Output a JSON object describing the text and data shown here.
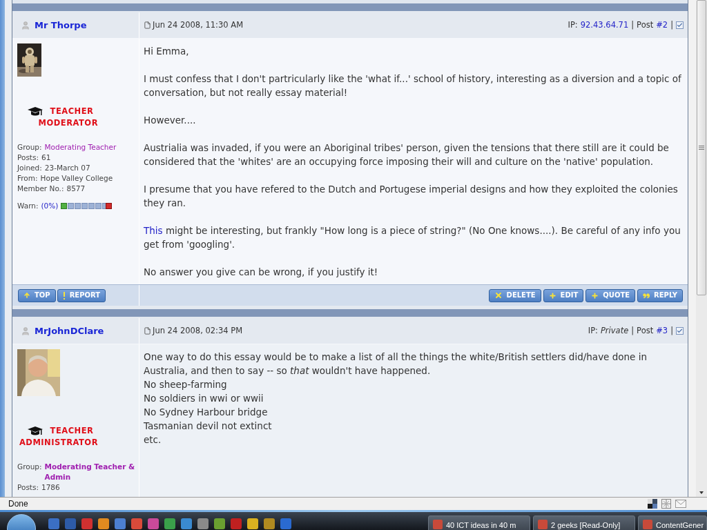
{
  "posts": [
    {
      "author": "Mr Thorpe",
      "date": "Jun 24 2008, 11:30 AM",
      "ip_label": "IP:",
      "ip": "92.43.64.71",
      "ip_private": false,
      "separators": [
        "|",
        "|"
      ],
      "post_label": "Post",
      "post_no": "#2",
      "checked": true,
      "avatar": {
        "kind": "picture"
      },
      "rank": [
        "TEACHER",
        "MODERATOR"
      ],
      "details": [
        {
          "label": "Group:",
          "value": "Moderating Teacher",
          "kind": "group",
          "bold": false
        },
        {
          "label": "Posts:",
          "value": "61",
          "kind": "plain"
        },
        {
          "label": "Joined:",
          "value": "23-March 07",
          "kind": "plain"
        },
        {
          "label": "From:",
          "value": "Hope Valley College",
          "kind": "plain"
        },
        {
          "label": "Member No.:",
          "value": "8577",
          "kind": "plain"
        }
      ],
      "warn": {
        "label": "Warn:",
        "value": "(0%)"
      },
      "body": [
        [
          {
            "text": "Hi Emma,"
          }
        ],
        [
          {
            "text": "I must confess that I don't partricularly like the 'what if...' school of history, interesting as a diversion and a topic of conversation, but not really essay material!"
          }
        ],
        [
          {
            "text": "However...."
          }
        ],
        [
          {
            "text": "Austrialia was invaded, if you were an Aboriginal tribes' person, given the tensions that there still are it could be considered that the 'whites' are an occupying force imposing their will and culture on the 'native' population."
          }
        ],
        [
          {
            "text": "I presume that you have refered to the Dutch and Portugese imperial designs and how they exploited the colonies they ran."
          }
        ],
        [
          {
            "link": "This",
            "text": " might be interesting, but frankly \"How long is a piece of string?\" (No One knows....). Be careful of any info you get from 'googling'."
          }
        ],
        [
          {
            "text": "No answer you give can be wrong, if you justify it!"
          }
        ]
      ],
      "left_buttons": [
        {
          "label": "TOP",
          "kind": "top"
        },
        {
          "label": "REPORT",
          "kind": "report"
        }
      ],
      "right_buttons": [
        {
          "label": "DELETE",
          "kind": "delete"
        },
        {
          "label": "EDIT",
          "kind": "edit"
        },
        {
          "label": "QUOTE",
          "kind": "quote"
        },
        {
          "label": "REPLY",
          "kind": "reply"
        }
      ]
    },
    {
      "author": "MrJohnDClare",
      "date": "Jun 24 2008, 02:34 PM",
      "ip_label": "IP:",
      "ip": "Private",
      "ip_private": true,
      "separators": [
        "|",
        "|"
      ],
      "post_label": "Post",
      "post_no": "#3",
      "checked": true,
      "avatar": {
        "kind": "picture"
      },
      "rank": [
        "TEACHER",
        "ADMINISTRATOR"
      ],
      "details": [
        {
          "label": "Group:",
          "value": "Moderating Teacher & Admin",
          "kind": "group",
          "bold": true
        },
        {
          "label": "Posts:",
          "value": "1786",
          "kind": "plain"
        }
      ],
      "body": [
        [
          {
            "text": "One way to do this essay would be to make a list of all the things the white/British settlers did/have done in Australia, and then to say -- so *that* wouldn't have happened."
          },
          {
            "text": "No sheep-farming"
          },
          {
            "text": "No soldiers in wwi or wwii"
          },
          {
            "text": "No Sydney Harbour bridge"
          },
          {
            "text": "Tasmanian devil not extinct"
          },
          {
            "text": "etc."
          }
        ]
      ]
    }
  ],
  "status_bar": {
    "text": "Done"
  },
  "taskbar": {
    "tasks": [
      {
        "label": "40 ICT ideas in 40 m"
      },
      {
        "label": "2 geeks [Read-Only]"
      },
      {
        "label": "ContentGener"
      }
    ]
  }
}
